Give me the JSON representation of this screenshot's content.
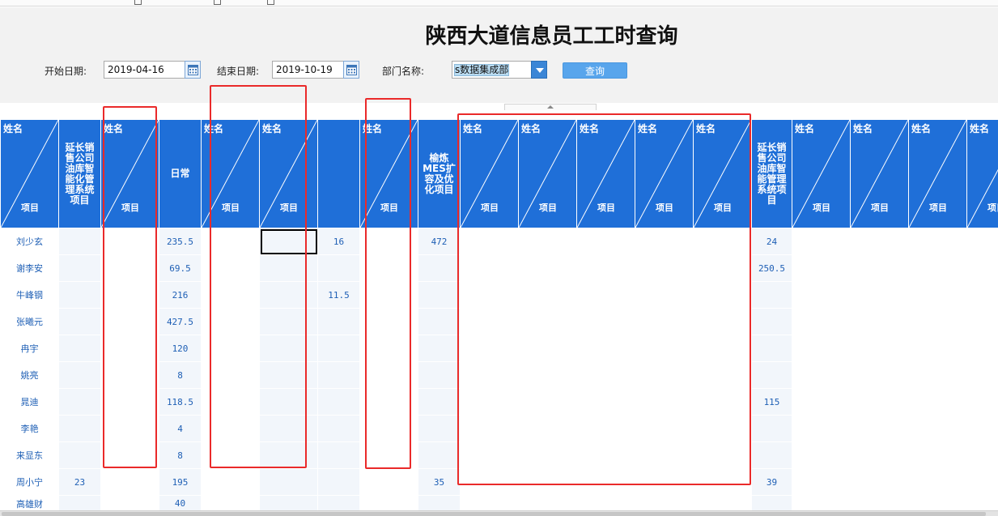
{
  "page": {
    "title": "陕西大道信息员工工时查询"
  },
  "filters": {
    "start_label": "开始日期:",
    "start_value": "2019-04-16",
    "end_label": "结束日期:",
    "end_value": "2019-10-19",
    "dept_label": "部门名称:",
    "dept_value": "s数据集成部",
    "query_label": "查询"
  },
  "icons": {
    "calendar": "calendar-icon",
    "dropdown": "chevron-down-icon",
    "collapse": "chevron-up-icon"
  },
  "colors": {
    "header_blue": "#1f6fd8",
    "highlight_red": "#ea2a2a",
    "button_blue": "#58a5ec",
    "cell_text": "#1e5fb5"
  },
  "table": {
    "diag_top": "姓名",
    "diag_bottom": "项目",
    "columns": [
      {
        "kind": "diag"
      },
      {
        "kind": "text",
        "label": "延长销售公司油库智能化管理系统项目"
      },
      {
        "kind": "diag"
      },
      {
        "kind": "text",
        "label": "日常"
      },
      {
        "kind": "diag"
      },
      {
        "kind": "diag"
      },
      {
        "kind": "text",
        "label": ""
      },
      {
        "kind": "diag"
      },
      {
        "kind": "text",
        "label": "榆炼MES扩容及优化项目"
      },
      {
        "kind": "diag"
      },
      {
        "kind": "diag"
      },
      {
        "kind": "diag"
      },
      {
        "kind": "diag"
      },
      {
        "kind": "diag"
      },
      {
        "kind": "text",
        "label": "延长销售公司油库智能管理系统项目"
      },
      {
        "kind": "diag"
      },
      {
        "kind": "diag"
      },
      {
        "kind": "diag"
      },
      {
        "kind": "diag"
      }
    ],
    "rows": [
      {
        "name": "刘少玄",
        "values": [
          "",
          "",
          "235.5",
          "",
          "",
          "16",
          "",
          "472",
          "",
          "",
          "",
          "",
          "",
          "24",
          "",
          "",
          "",
          ""
        ]
      },
      {
        "name": "谢李安",
        "values": [
          "",
          "",
          "69.5",
          "",
          "",
          "",
          "",
          "",
          "",
          "",
          "",
          "",
          "",
          "250.5",
          "",
          "",
          "",
          ""
        ]
      },
      {
        "name": "牛峰钢",
        "values": [
          "",
          "",
          "216",
          "",
          "",
          "11.5",
          "",
          "",
          "",
          "",
          "",
          "",
          "",
          "",
          "",
          "",
          "",
          ""
        ]
      },
      {
        "name": "张曦元",
        "values": [
          "",
          "",
          "427.5",
          "",
          "",
          "",
          "",
          "",
          "",
          "",
          "",
          "",
          "",
          "",
          "",
          "",
          "",
          ""
        ]
      },
      {
        "name": "冉宇",
        "values": [
          "",
          "",
          "120",
          "",
          "",
          "",
          "",
          "",
          "",
          "",
          "",
          "",
          "",
          "",
          "",
          "",
          "",
          ""
        ]
      },
      {
        "name": "姚亮",
        "values": [
          "",
          "",
          "8",
          "",
          "",
          "",
          "",
          "",
          "",
          "",
          "",
          "",
          "",
          "",
          "",
          "",
          "",
          ""
        ]
      },
      {
        "name": "晁迪",
        "values": [
          "",
          "",
          "118.5",
          "",
          "",
          "",
          "",
          "",
          "",
          "",
          "",
          "",
          "",
          "115",
          "",
          "",
          "",
          ""
        ]
      },
      {
        "name": "李艳",
        "values": [
          "",
          "",
          "4",
          "",
          "",
          "",
          "",
          "",
          "",
          "",
          "",
          "",
          "",
          "",
          "",
          "",
          "",
          ""
        ]
      },
      {
        "name": "来显东",
        "values": [
          "",
          "",
          "8",
          "",
          "",
          "",
          "",
          "",
          "",
          "",
          "",
          "",
          "",
          "",
          "",
          "",
          "",
          ""
        ]
      },
      {
        "name": "周小宁",
        "values": [
          "23",
          "",
          "195",
          "",
          "",
          "",
          "",
          "35",
          "",
          "",
          "",
          "",
          "",
          "39",
          "",
          "",
          "",
          ""
        ]
      },
      {
        "name": "高雄财",
        "values": [
          "",
          "",
          "40",
          "",
          "",
          "",
          "",
          "",
          "",
          "",
          "",
          "",
          "",
          "",
          "",
          "",
          "",
          ""
        ]
      }
    ]
  }
}
